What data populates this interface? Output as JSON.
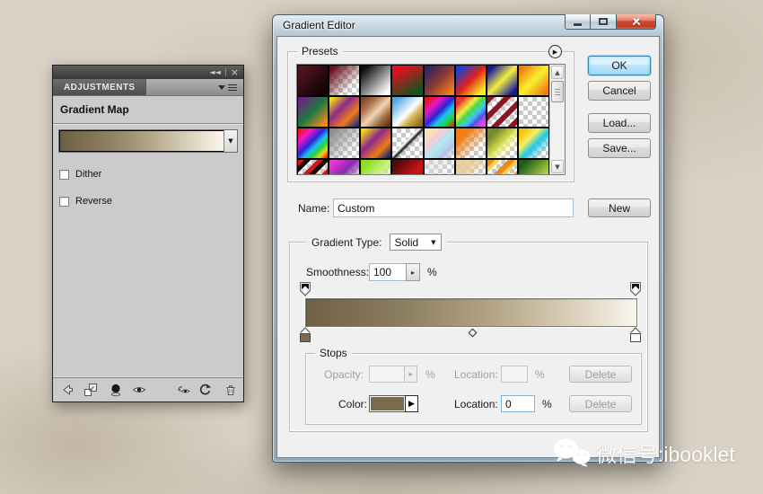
{
  "panel": {
    "header": {
      "collapse_icon": "◄◄",
      "separator": "|",
      "close_icon": "×"
    },
    "tab": "ADJUSTMENTS",
    "title": "Gradient Map",
    "gradient_preview_css": "linear-gradient(to right,#6e5f43 0%,#8d7f61 30%,#b3a688 55%,#ddd3bf 80%,#fbf7ef 100%)",
    "dither": {
      "label": "Dither",
      "checked": false
    },
    "reverse": {
      "label": "Reverse",
      "checked": false
    },
    "toolbar_icons": [
      "return-to-adjustment-list",
      "expanded-view",
      "clip-to-layer",
      "toggle-visibility",
      "view-previous-state",
      "reset",
      "delete-adjustment"
    ]
  },
  "dialog": {
    "title": "Gradient Editor",
    "window_buttons": [
      "minimize",
      "maximize",
      "close"
    ],
    "presets": {
      "label": "Presets",
      "flyout_icon": "▶",
      "scroll_up_icon": "▲",
      "scroll_down_icon": "▼",
      "items": [
        "linear-gradient(135deg,#5c1522,#130507 85%)",
        "linear-gradient(135deg,#681120 10%,rgba(104,17,32,0) 75%), repeating-conic-gradient(#c9c9c9 0% 25%,#ffffff 0% 50%) 0 0 / 10px 10px",
        "linear-gradient(135deg,#0e0e0e 12%,#fdfdfd 88%)",
        "linear-gradient(150deg,#e01020 18%,#15531f 85%)",
        "linear-gradient(135deg,#2e2566 10%,#8c3a34 50%,#f08019 90%)",
        "linear-gradient(135deg,#1b3fd1 12%,#e02218 50%,#f8ef25 88%)",
        "linear-gradient(135deg,#181a9e 12%,#f5ee3e 50%,#181a9e 88%)",
        "linear-gradient(135deg,#ef7d10 10%,#f9f02f 50%,#ef7d10 90%)",
        "linear-gradient(135deg,#6e2280 10%,#1d7a3e 50%,#ee8a1e 90%)",
        "linear-gradient(135deg,#f5d715 8%,#8a2a8a 38%,#ef7a17 68%,#232c86 95%)",
        "linear-gradient(135deg,#7e492a 8%,#b37b50 30%,#f0d6ba 52%,#9c6a3e 75%,#5f3318 95%)",
        "linear-gradient(135deg,#4fa3e0 10%,#bfe2f5 38%,#ffffff 52%,#d8b95e 66%,#8f6a1e 92%)",
        "linear-gradient(135deg,#ef1010 8%,#e817c0 30%,#2a23d8 50%,#19c5ef 65%,#23d33a 82%,#ef1010 100%)",
        "linear-gradient(135deg,rgba(240,20,20,.85) 15%,rgba(240,240,30,.85) 35%,rgba(40,210,60,.85) 50%,rgba(30,200,240,.85) 62%,rgba(60,60,230,.85) 75%,rgba(230,40,220,.85) 90%), repeating-conic-gradient(#c9c9c9 0% 25%,#ffffff 0% 50%) 0 0 / 10px 10px",
        "repeating-linear-gradient(135deg,#8c1628 0 6px,rgba(255,255,255,0) 6px 13px), repeating-conic-gradient(#c9c9c9 0% 25%,#ffffff 0% 50%) 0 0 / 10px 10px",
        "repeating-conic-gradient(#c9c9c9 0% 25%,#ffffff 0% 50%) 0 0 / 10px 10px",
        "linear-gradient(135deg,#f01616 5%,#ee17c8 25%,#2a23d8 45%,#1ac3ee 60%,#28d33a 72%,#ecd81a 84%,#f01616 97%)",
        "linear-gradient(135deg,#8f8f8f 10%,rgba(143,143,143,0) 80%), repeating-conic-gradient(#c9c9c9 0% 25%,#ffffff 0% 50%) 0 0 / 10px 10px",
        "linear-gradient(135deg,#f5d715 8%,#8a2a8a 40%,#ef7a17 70%,#1b2468 95%)",
        "linear-gradient(135deg,rgba(255,255,255,0) 42%,#ffffff 46%,#111111 52%,rgba(17,17,17,0) 58%), repeating-conic-gradient(#c9c9c9 0% 25%,#ffffff 0% 50%) 0 0 / 10px 10px",
        "linear-gradient(135deg,rgba(248,233,170,.95) 12%,rgba(246,200,215,.95) 35%,rgba(170,235,240,.95) 55%,rgba(185,190,235,.95) 78%,rgba(185,190,235,0) 95%), repeating-conic-gradient(#c9c9c9 0% 25%,#ffffff 0% 50%) 0 0 / 10px 10px",
        "linear-gradient(135deg,#ef7f16 25%,rgba(239,127,22,0) 72%), repeating-conic-gradient(#c9c9c9 0% 25%,#ffffff 0% 50%) 0 0 / 10px 10px",
        "linear-gradient(135deg,rgba(110,135,35,.95) 20%,rgba(200,210,60,.95) 45%,rgba(255,245,120,.6) 60%,rgba(255,255,255,0) 80%), repeating-conic-gradient(#c9c9c9 0% 25%,#ffffff 0% 50%) 0 0 / 10px 10px",
        "linear-gradient(135deg,#f5c816 15%,#f7ef60 35%,#24c8e8 55%,rgba(36,200,232,0) 85%), repeating-conic-gradient(#c9c9c9 0% 25%,#ffffff 0% 50%) 0 0 / 10px 10px",
        "repeating-linear-gradient(135deg,#d01818 0 5px,#1a0a0a 5px 10px,rgba(0,0,0,0) 10px 15px), repeating-conic-gradient(#c9c9c9 0% 25%,#ffffff 0% 50%) 0 0 / 10px 10px",
        "linear-gradient(135deg,#ee35d8 10%,#8a2ab0 45%,rgba(138,42,176,0) 80%), repeating-conic-gradient(#c9c9c9 0% 25%,#ffffff 0% 50%) 0 0 / 10px 10px",
        "linear-gradient(135deg,#8adf1f 15%,#c8ef7a 50%,rgba(200,239,122,0) 85%), repeating-conic-gradient(#c9c9c9 0% 25%,#ffffff 0% 50%) 0 0 / 10px 10px",
        "linear-gradient(135deg,#4a0a0c 10%,#d01218 60%,#8a0e12 95%)",
        "linear-gradient(135deg,rgba(220,220,220,.5) 35%,rgba(255,255,255,0) 60%), repeating-conic-gradient(#c9c9c9 0% 25%,#ffffff 0% 50%) 0 0 / 10px 10px",
        "linear-gradient(135deg,rgba(230,205,150,.9) 35%,rgba(230,205,150,0) 65%), repeating-conic-gradient(#c9c9c9 0% 25%,#ffffff 0% 50%) 0 0 / 10px 10px",
        "repeating-linear-gradient(135deg,#ef8a16 0 6px,#f8d050 6px 10px,rgba(248,208,80,0) 10px 16px), repeating-conic-gradient(#c9c9c9 0% 25%,#ffffff 0% 50%) 0 0 / 10px 10px",
        "linear-gradient(135deg,#1e5c1a 15%,#7aa832 50%,#d8e84a 80%)"
      ]
    },
    "buttons": {
      "ok": "OK",
      "cancel": "Cancel",
      "load": "Load...",
      "save": "Save...",
      "new": "New"
    },
    "name_label": "Name:",
    "name_value": "Custom",
    "gradient_type_label": "Gradient Type:",
    "gradient_type_value": "Solid",
    "combo_arrow_icon": "▼",
    "spinner_arrow_icon": "▸",
    "smoothness_label": "Smoothness:",
    "smoothness_value": "100",
    "percent": "%",
    "gradient_bar_css": "linear-gradient(to right,#6f6046 0%,#8d7f61 30%,#b5a788 58%,#ddd2bd 82%,#faf6ee 100%)",
    "stop_left_color": "#7a6b4e",
    "stop_right_color": "#fdfaf3",
    "stops": {
      "label": "Stops",
      "opacity_label": "Opacity:",
      "opacity_value": "",
      "location_label_top": "Location:",
      "location_value_top": "",
      "delete_label": "Delete",
      "color_label": "Color:",
      "color_swatch": "#7a6b4e",
      "swatch_arrow_icon": "▶",
      "location_label_bottom": "Location:",
      "location_value_bottom": "0"
    }
  },
  "watermark": {
    "text": "微信号:ibooklet"
  }
}
